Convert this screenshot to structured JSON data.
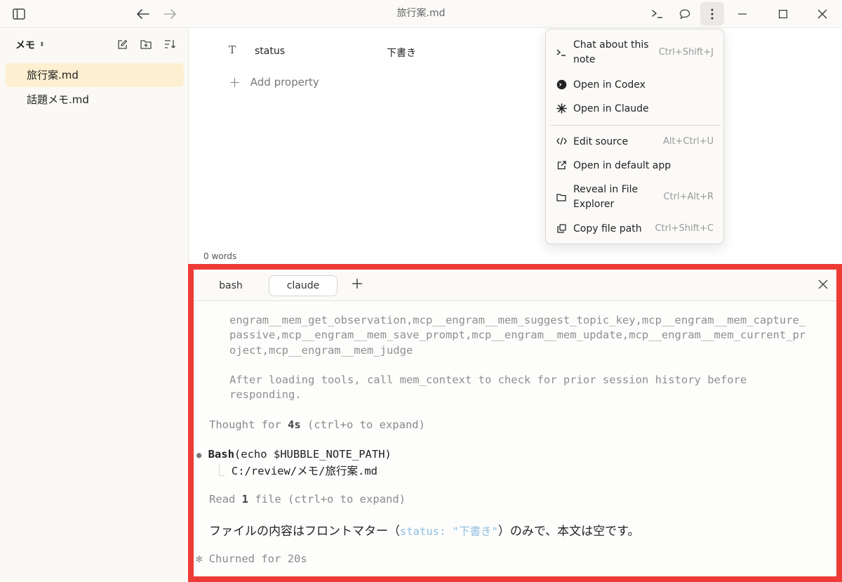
{
  "window": {
    "title": "旅行案.md"
  },
  "titlebar": {
    "icons": [
      "sidebar-toggle-icon",
      "arrow-left-icon",
      "arrow-right-icon",
      "terminal-icon",
      "chat-bubble-icon",
      "kebab-menu-icon",
      "minimize-icon",
      "maximize-icon",
      "close-icon"
    ]
  },
  "sidebar": {
    "folder": "メモ",
    "tools": [
      "new-note-icon",
      "new-folder-icon",
      "sort-icon"
    ],
    "files": [
      {
        "name": "旅行案.md",
        "active": true
      },
      {
        "name": "話題メモ.md",
        "active": false
      }
    ]
  },
  "editor": {
    "properties": [
      {
        "icon": "text-type-icon",
        "key": "status",
        "value": "下書き"
      }
    ],
    "add_property_label": "Add property",
    "word_count": "0 words"
  },
  "menu": {
    "items": [
      {
        "icon": "terminal-prompt-icon",
        "label": "Chat about this note",
        "shortcut": "Ctrl+Shift+J"
      },
      {
        "icon": "codex-icon",
        "label": "Open in Codex",
        "shortcut": ""
      },
      {
        "icon": "claude-icon",
        "label": "Open in Claude",
        "shortcut": ""
      },
      {
        "icon": "code-icon",
        "label": "Edit source",
        "shortcut": "Alt+Ctrl+U"
      },
      {
        "icon": "external-link-icon",
        "label": "Open in default app",
        "shortcut": ""
      },
      {
        "icon": "folder-icon",
        "label": "Reveal in File Explorer",
        "shortcut": "Ctrl+Alt+R"
      },
      {
        "icon": "copy-icon",
        "label": "Copy file path",
        "shortcut": "Ctrl+Shift+C"
      }
    ]
  },
  "terminal": {
    "tabs": [
      {
        "label": "bash",
        "active": false
      },
      {
        "label": "claude",
        "active": true
      }
    ],
    "lines": {
      "l1": "engram__mem_get_observation,mcp__engram__mem_suggest_topic_key,mcp__engram__mem_capture_",
      "l2": "passive,mcp__engram__mem_save_prompt,mcp__engram__mem_update,mcp__engram__mem_current_pr",
      "l3": "oject,mcp__engram__mem_judge",
      "l4": "After loading tools, call mem_context to check for prior session history before",
      "l5": "responding.",
      "thought_a": "Thought for ",
      "thought_b": "4s",
      "thought_c": " (ctrl+o to expand)",
      "bash_bullet": "●",
      "bash_name": "Bash",
      "bash_cmd": "(echo $HUBBLE_NOTE_PATH)",
      "bash_branch": "⎿",
      "bash_out": "C:/review/メモ/旅行案.md",
      "read_a": "Read ",
      "read_b": "1",
      "read_c": " file (ctrl+o to expand)",
      "ans_a": "ファイルの内容はフロントマター（",
      "ans_b": "status: \"下書き\"",
      "ans_c": "）のみで、本文は空です。",
      "churn_star": "✻",
      "churn": " Churned for 20s"
    }
  }
}
